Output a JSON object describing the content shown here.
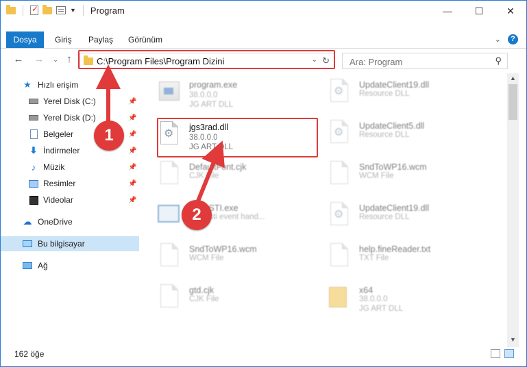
{
  "window": {
    "title": "Program",
    "controls": {
      "minimize": "—",
      "maximize": "☐",
      "close": "✕"
    }
  },
  "ribbon": {
    "tabs": [
      "Dosya",
      "Giriş",
      "Paylaş",
      "Görünüm"
    ],
    "expand_icon": "chevron-down-icon",
    "help_label": "?"
  },
  "address": {
    "path": "C:\\Program Files\\Program Dizini"
  },
  "search": {
    "placeholder": "Ara: Program"
  },
  "sidebar": {
    "items": [
      {
        "label": "Hızlı erişim",
        "icon": "star-icon"
      },
      {
        "label": "Yerel Disk (C:)",
        "icon": "drive-icon",
        "pinned": true
      },
      {
        "label": "Yerel Disk (D:)",
        "icon": "drive-icon",
        "pinned": true
      },
      {
        "label": "Belgeler",
        "icon": "documents-icon",
        "pinned": true
      },
      {
        "label": "İndirmeler",
        "icon": "download-icon",
        "pinned": true
      },
      {
        "label": "Müzik",
        "icon": "music-icon",
        "pinned": true
      },
      {
        "label": "Resimler",
        "icon": "pictures-icon",
        "pinned": true
      },
      {
        "label": "Videolar",
        "icon": "video-icon",
        "pinned": true
      },
      {
        "label": "OneDrive",
        "icon": "cloud-icon"
      },
      {
        "label": "Bu bilgisayar",
        "icon": "computer-icon",
        "selected": true
      },
      {
        "label": "Ağ",
        "icon": "network-icon"
      }
    ]
  },
  "files": {
    "left": [
      {
        "name": "program.exe",
        "line1": "38.0.0.0",
        "line2": "JG ART DLL",
        "icon": "exe-icon"
      },
      {
        "name": "jgs3rad.dll",
        "line1": "38.0.0.0",
        "line2": "JG ART DLL",
        "icon": "dll-gear-icon"
      },
      {
        "name": "DefaultFont.cjk",
        "line1": "CJK File",
        "line2": "",
        "icon": "document-icon"
      },
      {
        "name": "BabySTI.exe",
        "line1": "Baby sti event hand...",
        "line2": "",
        "icon": "window-icon"
      },
      {
        "name": "SndToWP16.wcm",
        "line1": "WCM File",
        "line2": "",
        "icon": "document-icon"
      },
      {
        "name": "gtd.cjk",
        "line1": "CJK File",
        "line2": "",
        "icon": "document-icon"
      }
    ],
    "right": [
      {
        "name": "UpdateClient19.dll",
        "line1": "Resource DLL",
        "line2": "",
        "icon": "dll-gear-icon"
      },
      {
        "name": "UpdateClient5.dll",
        "line1": "Resource DLL",
        "line2": "",
        "icon": "dll-gear-icon"
      },
      {
        "name": "SndToWP16.wcm",
        "line1": "WCM File",
        "line2": "",
        "icon": "document-icon"
      },
      {
        "name": "UpdateClient19.dll",
        "line1": "Resource DLL",
        "line2": "",
        "icon": "dll-gear-icon"
      },
      {
        "name": "help.fineReader.txt",
        "line1": "TXT File",
        "line2": "",
        "icon": "document-icon"
      },
      {
        "name": "x64",
        "line1": "38.0.0.0",
        "line2": "JG ART DLL",
        "icon": "folder-icon"
      }
    ]
  },
  "status": {
    "item_count": "162 öğe"
  },
  "annotations": {
    "step1": "1",
    "step2": "2",
    "color": "#e03a3a"
  }
}
